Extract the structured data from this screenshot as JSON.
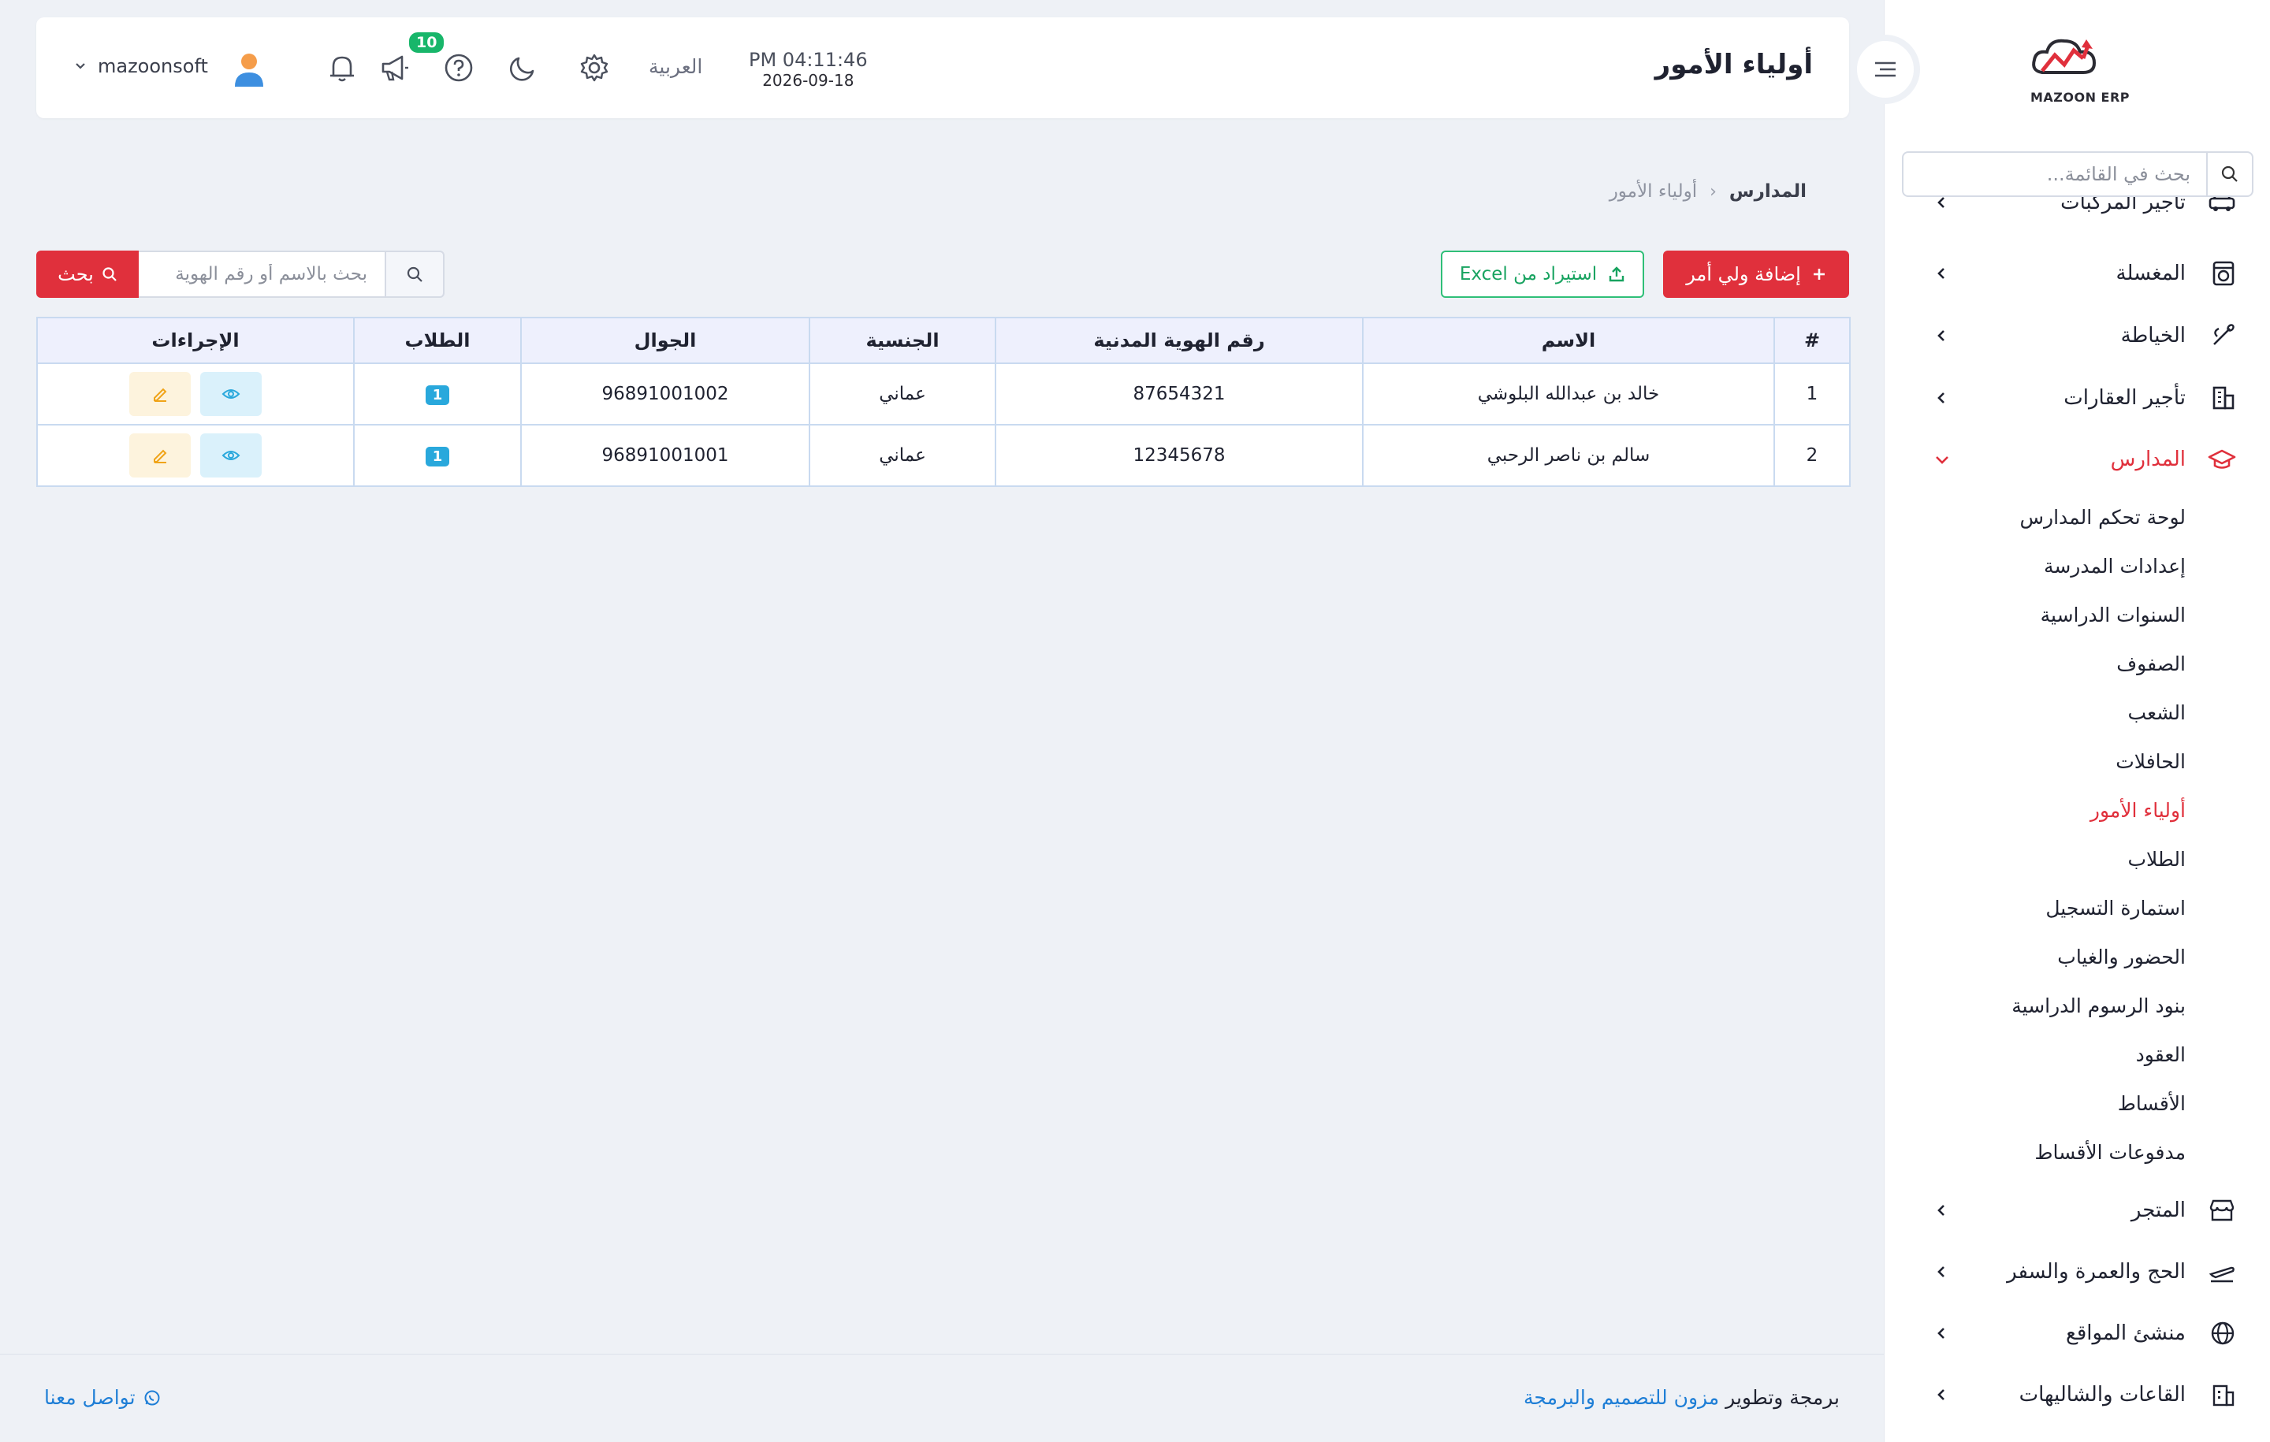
{
  "header": {
    "page_title": "أولياء الأمور",
    "time": "PM 04:11:46",
    "date": "2026-09-18",
    "language": "العربية",
    "notification_count": "10",
    "username": "mazoonsoft"
  },
  "logo": {
    "text": "MAZOON ERP"
  },
  "sidebar": {
    "search_placeholder": "بحث في القائمة...",
    "items": [
      {
        "label": "تأجير المركبات",
        "icon": "car-icon"
      },
      {
        "label": "المغسلة",
        "icon": "washing-machine-icon"
      },
      {
        "label": "الخياطة",
        "icon": "needle-icon"
      },
      {
        "label": "تأجير العقارات",
        "icon": "building-icon"
      },
      {
        "label": "المدارس",
        "icon": "graduation-cap-icon",
        "expanded": true
      },
      {
        "label": "المتجر",
        "icon": "store-icon"
      },
      {
        "label": "الحج والعمرة والسفر",
        "icon": "plane-icon"
      },
      {
        "label": "منشئ المواقع",
        "icon": "globe-icon"
      },
      {
        "label": "القاعات والشاليهات",
        "icon": "hall-icon"
      }
    ],
    "schools_submenu": [
      "لوحة تحكم المدارس",
      "إعدادات المدرسة",
      "السنوات الدراسية",
      "الصفوف",
      "الشعب",
      "الحافلات",
      "أولياء الأمور",
      "الطلاب",
      "استمارة التسجيل",
      "الحضور والغياب",
      "بنود الرسوم الدراسية",
      "العقود",
      "الأقساط",
      "مدفوعات الأقساط"
    ]
  },
  "breadcrumb": {
    "root": "المدارس",
    "current": "أولياء الأمور"
  },
  "toolbar": {
    "add_label": "إضافة ولي أمر",
    "import_label": "استيراد من Excel",
    "search_placeholder": "بحث بالاسم أو رقم الهوية",
    "search_button": "بحث"
  },
  "table": {
    "headers": [
      "#",
      "الاسم",
      "رقم الهوية المدنية",
      "الجنسية",
      "الجوال",
      "الطلاب",
      "الإجراءات"
    ],
    "rows": [
      {
        "index": "1",
        "name": "خالد بن عبدالله البلوشي",
        "civil_id": "87654321",
        "nationality": "عماني",
        "mobile": "96891001002",
        "students": "1"
      },
      {
        "index": "2",
        "name": "سالم بن ناصر الرحبي",
        "civil_id": "12345678",
        "nationality": "عماني",
        "mobile": "96891001001",
        "students": "1"
      }
    ]
  },
  "footer": {
    "credit_prefix": "برمجة وتطوير",
    "credit_link": "مزون للتصميم والبرمجة",
    "contact": "تواصل معنا"
  },
  "colors": {
    "accent": "#e0303c",
    "success": "#18b66a",
    "link": "#1e7ed6",
    "info": "#29a8dc"
  }
}
